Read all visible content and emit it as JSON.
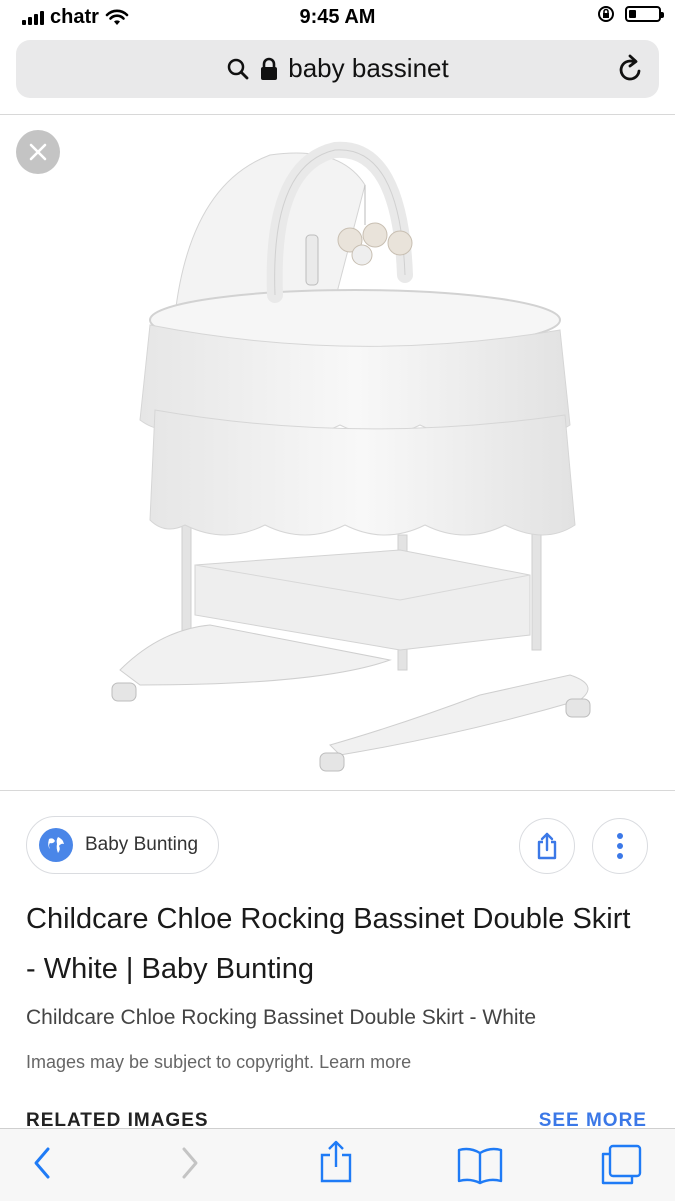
{
  "status_bar": {
    "carrier": "chatr",
    "time": "9:45 AM"
  },
  "address_bar": {
    "query": "baby bassinet",
    "icons": [
      "search-icon",
      "lock-icon",
      "reload-icon"
    ]
  },
  "image_viewer": {
    "image_subject": "white rocking bassinet",
    "close_icon": "close-icon"
  },
  "result": {
    "source_name": "Baby Bunting",
    "title": "Childcare Chloe Rocking Bassinet Double Skirt - White | Baby Bunting",
    "subtitle": "Childcare Chloe Rocking Bassinet Double Skirt - White",
    "copyright_note": "Images may be subject to copyright. Learn more",
    "related_heading": "RELATED IMAGES",
    "see_more_label": "SEE MORE"
  },
  "colors": {
    "accent": "#3b78e7",
    "globe": "#4a86e8",
    "urlbar_bg": "#e9e9ea",
    "toolbar_icons": "#1f7bf6"
  },
  "toolbar": {
    "icons": [
      "back-icon",
      "forward-icon",
      "share-icon",
      "bookmarks-icon",
      "tabs-icon"
    ]
  }
}
